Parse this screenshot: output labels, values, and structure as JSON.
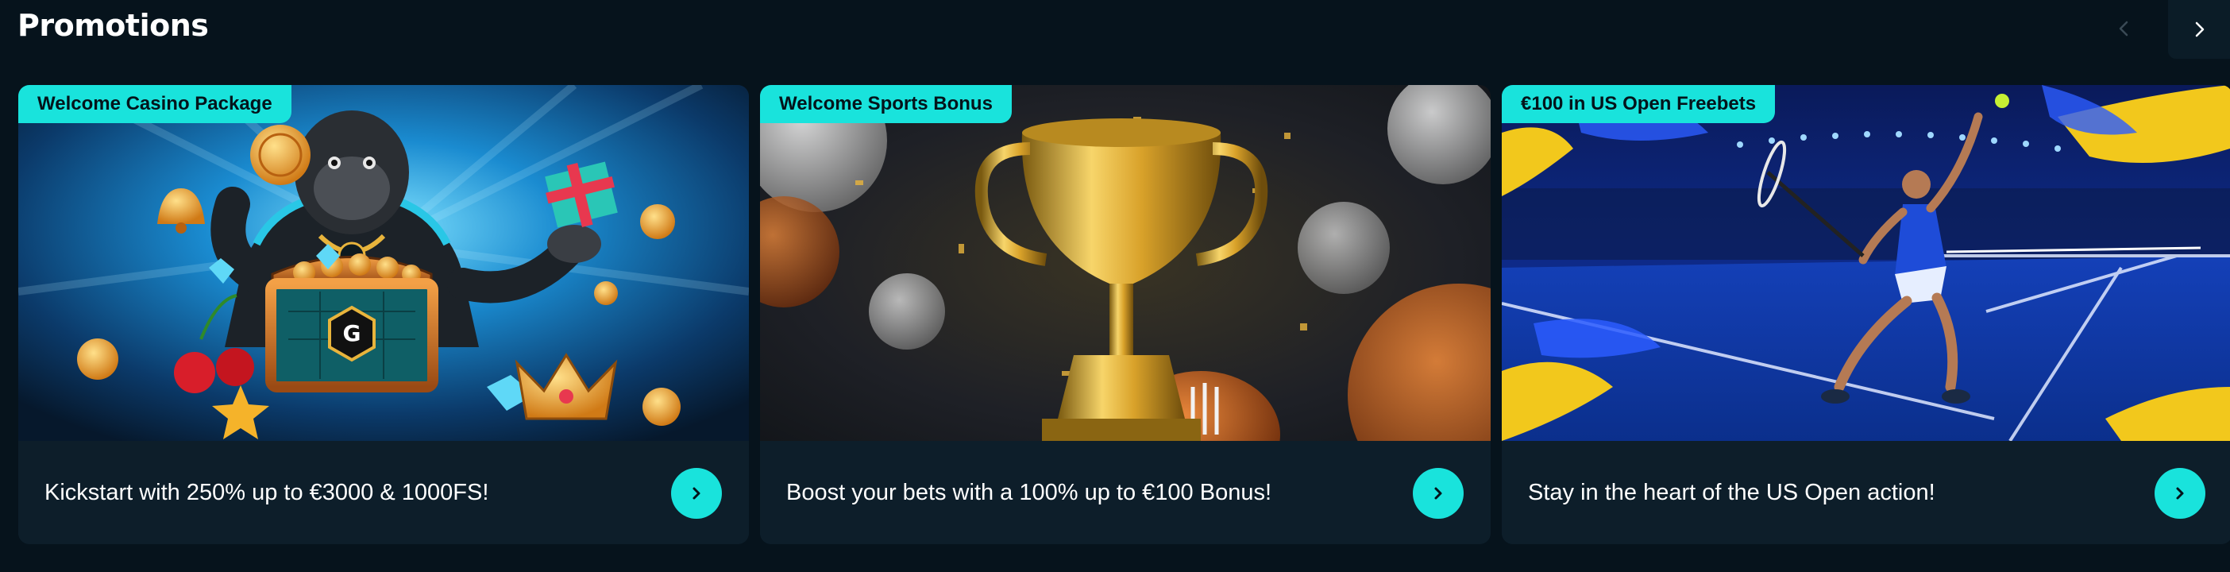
{
  "header": {
    "title": "Promotions",
    "prev_icon": "chevron-left-icon",
    "next_icon": "chevron-right-icon"
  },
  "colors": {
    "background": "#06131c",
    "card": "#0d1e2a",
    "accent": "#19e3dc",
    "badge_text": "#04141b"
  },
  "promotions": [
    {
      "badge": "Welcome Casino Package",
      "text": "Kickstart with 250% up to €3000 & 1000FS!",
      "image": "casino-gorilla-treasure-chest",
      "button_icon": "chevron-right-icon"
    },
    {
      "badge": "Welcome Sports Bonus",
      "text": "Boost your bets with a 100% up to €100 Bonus!",
      "image": "golden-trophy-sports-balls",
      "button_icon": "chevron-right-icon"
    },
    {
      "badge": "€100 in US Open Freebets",
      "text": "Stay in the heart of the US Open action!",
      "image": "tennis-player-serving",
      "button_icon": "chevron-right-icon"
    }
  ]
}
